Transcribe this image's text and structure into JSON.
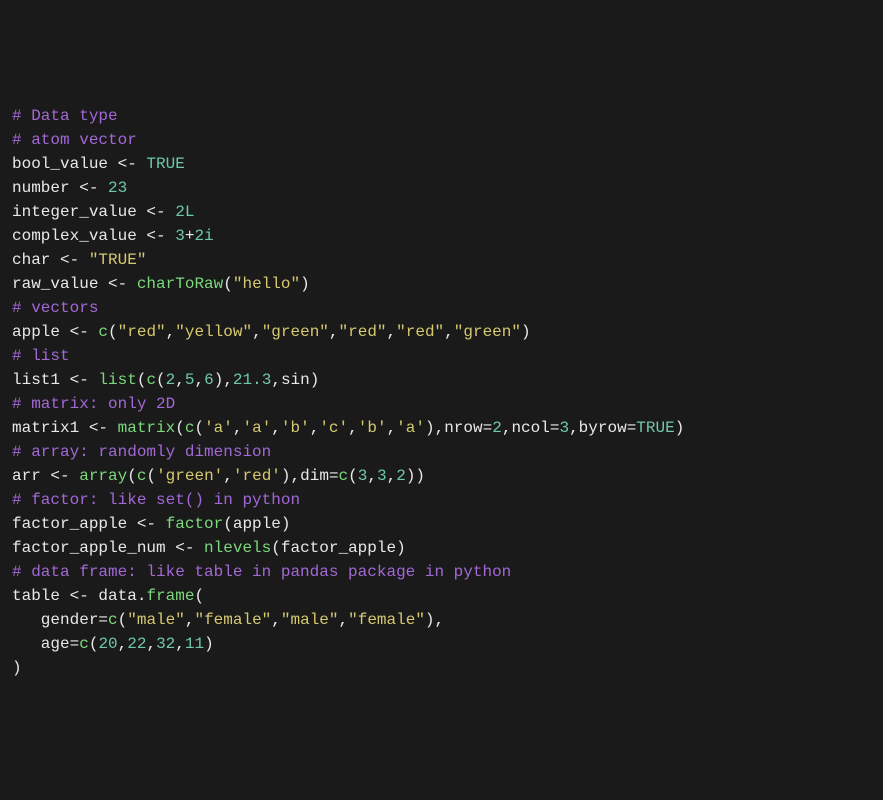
{
  "lines": [
    {
      "tokens": [
        {
          "cls": "comment",
          "t": "# Data type"
        }
      ]
    },
    {
      "tokens": [
        {
          "cls": "comment",
          "t": "# atom vector"
        }
      ]
    },
    {
      "tokens": [
        {
          "cls": "ident",
          "t": "bool_value"
        },
        {
          "cls": "op",
          "t": " <- "
        },
        {
          "cls": "const",
          "t": "TRUE"
        }
      ]
    },
    {
      "tokens": [
        {
          "cls": "ident",
          "t": "number"
        },
        {
          "cls": "op",
          "t": " <- "
        },
        {
          "cls": "num",
          "t": "23"
        }
      ]
    },
    {
      "tokens": [
        {
          "cls": "ident",
          "t": "integer_value"
        },
        {
          "cls": "op",
          "t": " <- "
        },
        {
          "cls": "num",
          "t": "2L"
        }
      ]
    },
    {
      "tokens": [
        {
          "cls": "ident",
          "t": "complex_value"
        },
        {
          "cls": "op",
          "t": " <- "
        },
        {
          "cls": "num",
          "t": "3"
        },
        {
          "cls": "op",
          "t": "+"
        },
        {
          "cls": "num",
          "t": "2i"
        }
      ]
    },
    {
      "tokens": [
        {
          "cls": "ident",
          "t": "char"
        },
        {
          "cls": "op",
          "t": " <- "
        },
        {
          "cls": "str",
          "t": "\"TRUE\""
        }
      ]
    },
    {
      "tokens": [
        {
          "cls": "ident",
          "t": "raw_value"
        },
        {
          "cls": "op",
          "t": " <- "
        },
        {
          "cls": "func",
          "t": "charToRaw"
        },
        {
          "cls": "paren",
          "t": "("
        },
        {
          "cls": "str",
          "t": "\"hello\""
        },
        {
          "cls": "paren",
          "t": ")"
        }
      ]
    },
    {
      "tokens": [
        {
          "cls": "comment",
          "t": "# vectors"
        }
      ]
    },
    {
      "tokens": [
        {
          "cls": "ident",
          "t": "apple"
        },
        {
          "cls": "op",
          "t": " <- "
        },
        {
          "cls": "func",
          "t": "c"
        },
        {
          "cls": "paren",
          "t": "("
        },
        {
          "cls": "str",
          "t": "\"red\""
        },
        {
          "cls": "op",
          "t": ","
        },
        {
          "cls": "str",
          "t": "\"yellow\""
        },
        {
          "cls": "op",
          "t": ","
        },
        {
          "cls": "str",
          "t": "\"green\""
        },
        {
          "cls": "op",
          "t": ","
        },
        {
          "cls": "str",
          "t": "\"red\""
        },
        {
          "cls": "op",
          "t": ","
        },
        {
          "cls": "str",
          "t": "\"red\""
        },
        {
          "cls": "op",
          "t": ","
        },
        {
          "cls": "str",
          "t": "\"green\""
        },
        {
          "cls": "paren",
          "t": ")"
        }
      ]
    },
    {
      "tokens": [
        {
          "cls": "comment",
          "t": "# list"
        }
      ]
    },
    {
      "tokens": [
        {
          "cls": "ident",
          "t": "list1"
        },
        {
          "cls": "op",
          "t": " <- "
        },
        {
          "cls": "func",
          "t": "list"
        },
        {
          "cls": "paren",
          "t": "("
        },
        {
          "cls": "func",
          "t": "c"
        },
        {
          "cls": "paren",
          "t": "("
        },
        {
          "cls": "num",
          "t": "2"
        },
        {
          "cls": "op",
          "t": ","
        },
        {
          "cls": "num",
          "t": "5"
        },
        {
          "cls": "op",
          "t": ","
        },
        {
          "cls": "num",
          "t": "6"
        },
        {
          "cls": "paren",
          "t": ")"
        },
        {
          "cls": "op",
          "t": ","
        },
        {
          "cls": "num",
          "t": "21.3"
        },
        {
          "cls": "op",
          "t": ","
        },
        {
          "cls": "ident",
          "t": "sin"
        },
        {
          "cls": "paren",
          "t": ")"
        }
      ]
    },
    {
      "tokens": [
        {
          "cls": "comment",
          "t": "# matrix: only 2D"
        }
      ]
    },
    {
      "tokens": [
        {
          "cls": "ident",
          "t": "matrix1"
        },
        {
          "cls": "op",
          "t": " <- "
        },
        {
          "cls": "func",
          "t": "matrix"
        },
        {
          "cls": "paren",
          "t": "("
        },
        {
          "cls": "func",
          "t": "c"
        },
        {
          "cls": "paren",
          "t": "("
        },
        {
          "cls": "str",
          "t": "'a'"
        },
        {
          "cls": "op",
          "t": ","
        },
        {
          "cls": "str",
          "t": "'a'"
        },
        {
          "cls": "op",
          "t": ","
        },
        {
          "cls": "str",
          "t": "'b'"
        },
        {
          "cls": "op",
          "t": ","
        },
        {
          "cls": "str",
          "t": "'c'"
        },
        {
          "cls": "op",
          "t": ","
        },
        {
          "cls": "str",
          "t": "'b'"
        },
        {
          "cls": "op",
          "t": ","
        },
        {
          "cls": "str",
          "t": "'a'"
        },
        {
          "cls": "paren",
          "t": ")"
        },
        {
          "cls": "op",
          "t": ","
        },
        {
          "cls": "kwarg",
          "t": "nrow"
        },
        {
          "cls": "op",
          "t": "="
        },
        {
          "cls": "num",
          "t": "2"
        },
        {
          "cls": "op",
          "t": ","
        },
        {
          "cls": "kwarg",
          "t": "ncol"
        },
        {
          "cls": "op",
          "t": "="
        },
        {
          "cls": "num",
          "t": "3"
        },
        {
          "cls": "op",
          "t": ","
        },
        {
          "cls": "kwarg",
          "t": "byrow"
        },
        {
          "cls": "op",
          "t": "="
        },
        {
          "cls": "const",
          "t": "TRUE"
        },
        {
          "cls": "paren",
          "t": ")"
        }
      ]
    },
    {
      "tokens": [
        {
          "cls": "comment",
          "t": "# array: randomly dimension"
        }
      ]
    },
    {
      "tokens": [
        {
          "cls": "ident",
          "t": "arr"
        },
        {
          "cls": "op",
          "t": " <- "
        },
        {
          "cls": "func",
          "t": "array"
        },
        {
          "cls": "paren",
          "t": "("
        },
        {
          "cls": "func",
          "t": "c"
        },
        {
          "cls": "paren",
          "t": "("
        },
        {
          "cls": "str",
          "t": "'green'"
        },
        {
          "cls": "op",
          "t": ","
        },
        {
          "cls": "str",
          "t": "'red'"
        },
        {
          "cls": "paren",
          "t": ")"
        },
        {
          "cls": "op",
          "t": ","
        },
        {
          "cls": "kwarg",
          "t": "dim"
        },
        {
          "cls": "op",
          "t": "="
        },
        {
          "cls": "func",
          "t": "c"
        },
        {
          "cls": "paren",
          "t": "("
        },
        {
          "cls": "num",
          "t": "3"
        },
        {
          "cls": "op",
          "t": ","
        },
        {
          "cls": "num",
          "t": "3"
        },
        {
          "cls": "op",
          "t": ","
        },
        {
          "cls": "num",
          "t": "2"
        },
        {
          "cls": "paren",
          "t": ")"
        },
        {
          "cls": "paren",
          "t": ")"
        }
      ]
    },
    {
      "tokens": [
        {
          "cls": "comment",
          "t": "# factor: like set() in python"
        }
      ]
    },
    {
      "tokens": [
        {
          "cls": "ident",
          "t": "factor_apple"
        },
        {
          "cls": "op",
          "t": " <- "
        },
        {
          "cls": "func",
          "t": "factor"
        },
        {
          "cls": "paren",
          "t": "("
        },
        {
          "cls": "ident",
          "t": "apple"
        },
        {
          "cls": "paren",
          "t": ")"
        }
      ]
    },
    {
      "tokens": [
        {
          "cls": "ident",
          "t": "factor_apple_num"
        },
        {
          "cls": "op",
          "t": " <- "
        },
        {
          "cls": "func",
          "t": "nlevels"
        },
        {
          "cls": "paren",
          "t": "("
        },
        {
          "cls": "ident",
          "t": "factor_apple"
        },
        {
          "cls": "paren",
          "t": ")"
        }
      ]
    },
    {
      "tokens": [
        {
          "cls": "comment",
          "t": "# data frame: like table in pandas package in python"
        }
      ]
    },
    {
      "tokens": [
        {
          "cls": "ident",
          "t": "table"
        },
        {
          "cls": "op",
          "t": " <- "
        },
        {
          "cls": "ident",
          "t": "data"
        },
        {
          "cls": "op",
          "t": "."
        },
        {
          "cls": "func",
          "t": "frame"
        },
        {
          "cls": "paren",
          "t": "("
        }
      ]
    },
    {
      "tokens": [
        {
          "cls": "ident",
          "t": "   gender"
        },
        {
          "cls": "op",
          "t": "="
        },
        {
          "cls": "func",
          "t": "c"
        },
        {
          "cls": "paren",
          "t": "("
        },
        {
          "cls": "str",
          "t": "\"male\""
        },
        {
          "cls": "op",
          "t": ","
        },
        {
          "cls": "str",
          "t": "\"female\""
        },
        {
          "cls": "op",
          "t": ","
        },
        {
          "cls": "str",
          "t": "\"male\""
        },
        {
          "cls": "op",
          "t": ","
        },
        {
          "cls": "str",
          "t": "\"female\""
        },
        {
          "cls": "paren",
          "t": ")"
        },
        {
          "cls": "op",
          "t": ","
        }
      ]
    },
    {
      "tokens": [
        {
          "cls": "ident",
          "t": "   age"
        },
        {
          "cls": "op",
          "t": "="
        },
        {
          "cls": "func",
          "t": "c"
        },
        {
          "cls": "paren",
          "t": "("
        },
        {
          "cls": "num",
          "t": "20"
        },
        {
          "cls": "op",
          "t": ","
        },
        {
          "cls": "num",
          "t": "22"
        },
        {
          "cls": "op",
          "t": ","
        },
        {
          "cls": "num",
          "t": "32"
        },
        {
          "cls": "op",
          "t": ","
        },
        {
          "cls": "num",
          "t": "11"
        },
        {
          "cls": "paren",
          "t": ")"
        }
      ]
    },
    {
      "tokens": [
        {
          "cls": "paren",
          "t": ")"
        }
      ]
    }
  ]
}
